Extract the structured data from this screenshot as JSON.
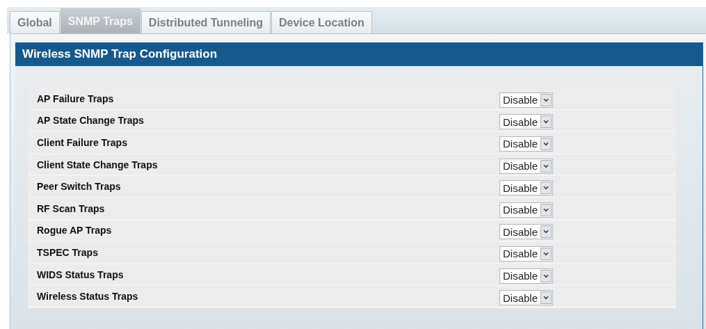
{
  "tabs": [
    {
      "label": "Global",
      "selected": false
    },
    {
      "label": "SNMP Traps",
      "selected": true
    },
    {
      "label": "Distributed Tunneling",
      "selected": false
    },
    {
      "label": "Device Location",
      "selected": false
    }
  ],
  "panel": {
    "title": "Wireless SNMP Trap Configuration",
    "rows": [
      {
        "label": "AP Failure Traps",
        "value": "Disable"
      },
      {
        "label": "AP State Change Traps",
        "value": "Disable"
      },
      {
        "label": "Client Failure Traps",
        "value": "Disable"
      },
      {
        "label": "Client State Change Traps",
        "value": "Disable"
      },
      {
        "label": "Peer Switch Traps",
        "value": "Disable"
      },
      {
        "label": "RF Scan Traps",
        "value": "Disable"
      },
      {
        "label": "Rogue AP Traps",
        "value": "Disable"
      },
      {
        "label": "TSPEC Traps",
        "value": "Disable"
      },
      {
        "label": "WIDS Status Traps",
        "value": "Disable"
      },
      {
        "label": "Wireless Status Traps",
        "value": "Disable"
      }
    ]
  }
}
